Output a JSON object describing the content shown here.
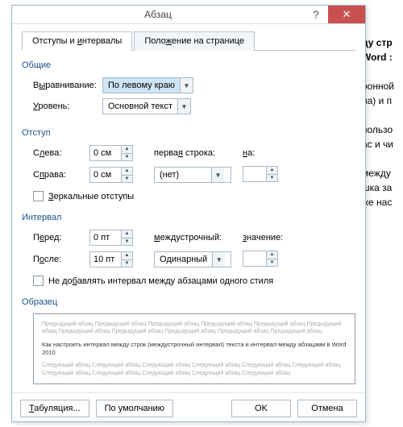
{
  "window": {
    "title": "Абзац",
    "help": "?",
    "close": "✕"
  },
  "tabs": {
    "indent": "Отступы и интервалы",
    "position": "Положение на странице"
  },
  "group_general": "Общие",
  "alignment": {
    "label_pre": "В",
    "label_u": "ы",
    "label_post": "равнивание:",
    "value": "По левому краю"
  },
  "level": {
    "label_u": "У",
    "label_post": "ровень:",
    "value": "Основной текст"
  },
  "group_indent": "Отступ",
  "indent_left": {
    "label_pre": "С",
    "label_u": "л",
    "label_post": "ева:",
    "value": "0 см"
  },
  "indent_right": {
    "label_pre": "С",
    "label_u": "п",
    "label_post": "рава:",
    "value": "0 см"
  },
  "first_line": {
    "label_pre": "перва",
    "label_u": "я",
    "label_post": " строка:",
    "value": "(нет)"
  },
  "by1": {
    "label_u": "н",
    "label_post": "а:",
    "value": ""
  },
  "mirror": {
    "label_u": "З",
    "label_post": "еркальные отступы"
  },
  "group_spacing": "Интервал",
  "before": {
    "label_pre": "П",
    "label_u": "е",
    "label_post": "ред:",
    "value": "0 пт"
  },
  "after": {
    "label_pre": "П",
    "label_u": "о",
    "label_post": "сле:",
    "value": "10 пт"
  },
  "line_spacing": {
    "label_u": "м",
    "label_post": "еждустрочный:",
    "value": "Одинарный"
  },
  "by2": {
    "label_u": "з",
    "label_post": "начение:",
    "value": ""
  },
  "no_space": {
    "label_pre": "Не до",
    "label_u": "б",
    "label_post": "авлять интервал между абзацами одного стиля"
  },
  "group_sample": "Образец",
  "sample": {
    "prev": "Предыдущий абзац Предыдущий абзац Предыдущий абзац Предыдущий абзац Предыдущий абзац Предыдущий абзац Предыдущий абзац Предыдущий абзац Предыдущий абзац Предыдущий абзац Предыдущий абзац",
    "mid": "Как настроить интервал между строк (междустрочный интервал) текста  и интервал между абзацами в Word 2010",
    "next": "Следующий абзац Следующий абзац Следующий абзац Следующий абзац Следующий абзац Следующий абзац Следующий абзац Следующий абзац Следующий абзац Следующий абзац Следующий абзац"
  },
  "footer": {
    "tabs": "Табуляция...",
    "default": "По умолчанию",
    "ok": "OK",
    "cancel": "Отмена"
  },
  "bg": {
    "l1": "ду стр",
    "l2": "Word :",
    "l3": "ронной",
    "l4": "на) и п",
    "l5": "пользо",
    "l6": "ас и чи",
    "l7": "между",
    "l8": "шка за",
    "l9": "же нас"
  }
}
